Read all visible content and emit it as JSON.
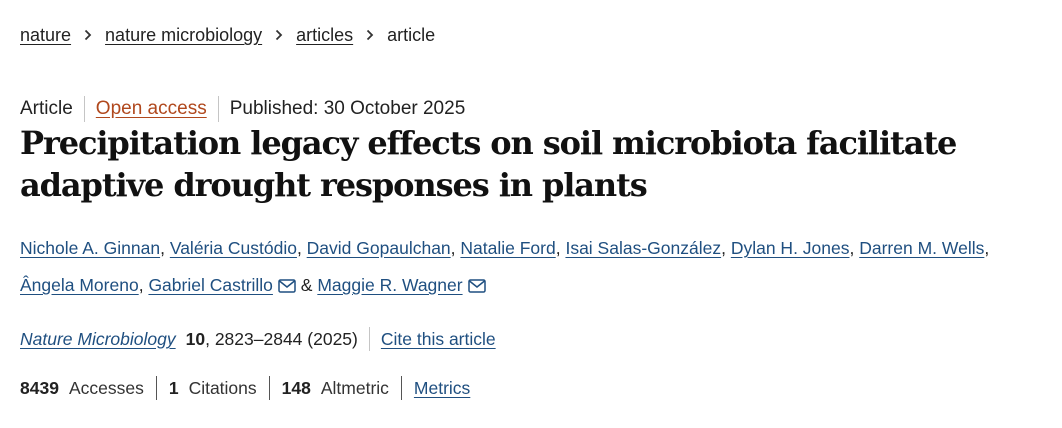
{
  "breadcrumb": {
    "items": [
      "nature",
      "nature microbiology",
      "articles"
    ],
    "current": "article",
    "separator_icon": "chevron-right-icon"
  },
  "meta": {
    "type": "Article",
    "access": "Open access",
    "published": "Published: 30 October 2025"
  },
  "title_lines": [
    "Precipitation legacy effects on soil microbiota facilitate",
    "adaptive drought responses in plants"
  ],
  "authors": [
    "Nichole A. Ginnan",
    "Valéria Custódio",
    "David Gopaulchan",
    "Natalie Ford",
    "Isai Salas-González",
    "Dylan H. Jones",
    "Darren M. Wells",
    "Ângela Moreno",
    "Gabriel Castrillo",
    "Maggie R. Wagner"
  ],
  "author_separator": ", ",
  "author_and": " & ",
  "mail_icon": "envelope-icon",
  "citation": {
    "journal": "Nature Microbiology",
    "volume": "10",
    "pages_year": ", 2823–2844 (2025)",
    "cite_link": "Cite this article"
  },
  "metrics": {
    "accesses_num": "8439",
    "accesses_label": "Accesses",
    "citations_num": "1",
    "citations_label": "Citations",
    "altmetric_num": "148",
    "altmetric_label": "Altmetric",
    "metrics_link": "Metrics"
  },
  "colors": {
    "link": "#1f4f80",
    "open_access": "#b0481d",
    "text": "#222222"
  }
}
